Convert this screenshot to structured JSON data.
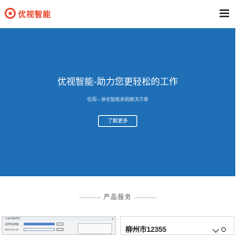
{
  "header": {
    "brand": "优视智能",
    "logo_icon": "eye-logo-icon",
    "menu_icon": "hamburger-menu-icon"
  },
  "hero": {
    "title": "优视智能-助力您更轻松的工作",
    "subtitle": "优视—体化智能系统解决方案",
    "button_label": "了解更多",
    "background": "#1e6fb6"
  },
  "services": {
    "section_title": "产品服务",
    "card_left": {
      "window_title": "Y-ACKRIPIT",
      "rows": [
        {
          "label": "设置所在网络"
        },
        {
          "label": "2019-01-18"
        }
      ]
    },
    "card_right": {
      "title": "柳州市12355"
    }
  }
}
